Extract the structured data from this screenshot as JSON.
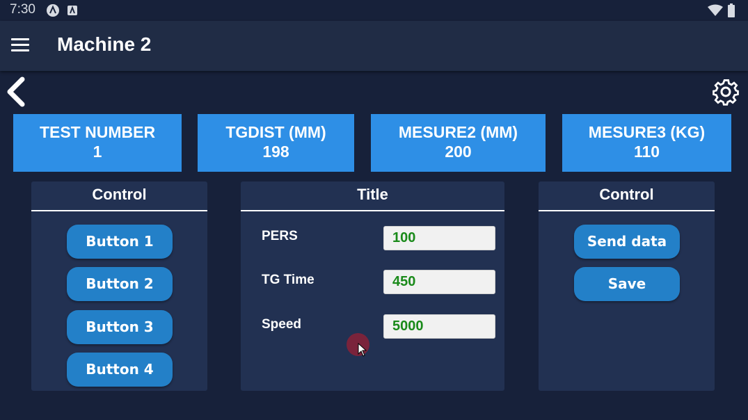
{
  "status_bar": {
    "time": "7:30",
    "icons": [
      "app-a-icon",
      "app-square-a-icon",
      "wifi-icon",
      "battery-icon"
    ]
  },
  "app_bar": {
    "title": "Machine 2",
    "menu_icon": "menu-icon"
  },
  "nav": {
    "back_icon": "chevron-left-icon",
    "settings_icon": "gear-icon"
  },
  "metrics": [
    {
      "label": "TEST NUMBER",
      "value": "1"
    },
    {
      "label": "TGDIST (MM)",
      "value": "198"
    },
    {
      "label": "MESURE2 (MM)",
      "value": "200"
    },
    {
      "label": "MESURE3 (KG)",
      "value": "110"
    }
  ],
  "left_panel": {
    "title": "Control",
    "buttons": [
      "Button 1",
      "Button 2",
      "Button 3",
      "Button 4"
    ]
  },
  "center_panel": {
    "title": "Title",
    "fields": [
      {
        "label": "PERS",
        "value": "100"
      },
      {
        "label": "TG Time",
        "value": "450"
      },
      {
        "label": "Speed",
        "value": "5000"
      }
    ]
  },
  "right_panel": {
    "title": "Control",
    "buttons": [
      "Send data",
      "Save"
    ]
  },
  "colors": {
    "background": "#17213a",
    "app_bar": "#202c45",
    "metric_card": "#2e8fe6",
    "panel": "#223152",
    "button": "#2380c8",
    "input_text": "#1a8a1a"
  }
}
